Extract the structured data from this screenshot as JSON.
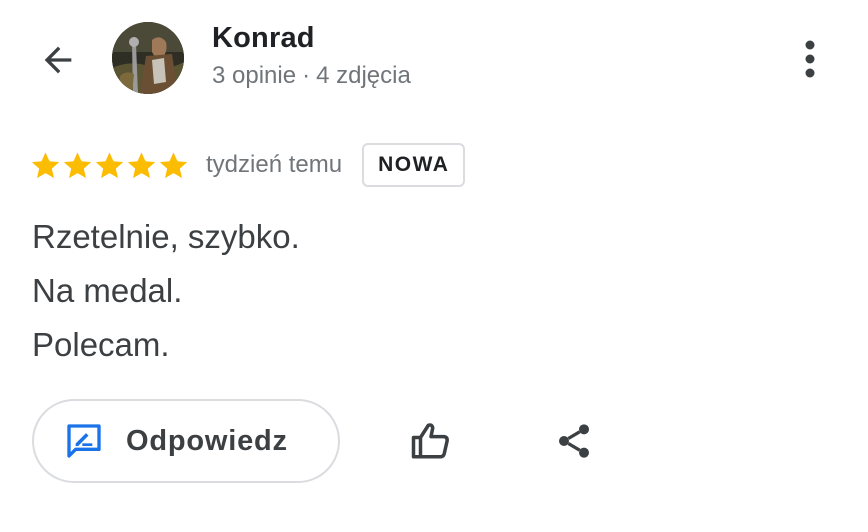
{
  "header": {
    "back_icon": "arrow-back-icon",
    "reviewer_name": "Konrad",
    "reviews_count": "3 opinie",
    "separator": "·",
    "photos_count": "4 zdjęcia",
    "more_icon": "more-vert-icon"
  },
  "review": {
    "rating": 5,
    "rating_max": 5,
    "star_color": "#fbbc04",
    "time_ago": "tydzień temu",
    "badge": "NOWA",
    "text_lines": [
      "Rzetelnie, szybko.",
      "Na medal.",
      "Polecam."
    ]
  },
  "actions": {
    "reply_label": "Odpowiedz",
    "reply_icon": "rate-review-icon",
    "reply_icon_color": "#1a73e8",
    "like_icon": "thumb-up-icon",
    "share_icon": "share-icon"
  }
}
